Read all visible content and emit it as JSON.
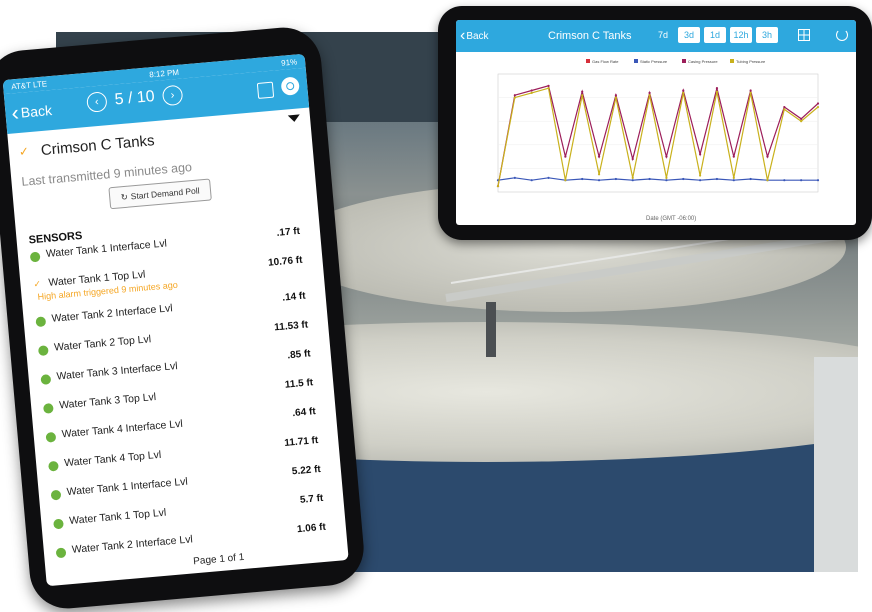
{
  "left_phone": {
    "status_bar": {
      "carrier": "AT&T LTE",
      "time": "8:12 PM",
      "battery": "91%"
    },
    "nav": {
      "back_label": "Back",
      "pager": "5 / 10"
    },
    "site_name": "Crimson C Tanks",
    "last_transmitted": "Last transmitted 9 minutes ago",
    "demand_poll_label": "Start Demand Poll",
    "sensors_title": "SENSORS",
    "sensors": [
      {
        "label": "Water Tank 1 Interface Lvl",
        "value": ".17 ft"
      },
      {
        "label": "Water Tank 1 Top Lvl",
        "value": "10.76 ft",
        "alarm": "High alarm triggered 9 minutes ago"
      },
      {
        "label": "Water Tank 2 Interface Lvl",
        "value": ".14 ft"
      },
      {
        "label": "Water Tank 2 Top Lvl",
        "value": "11.53 ft"
      },
      {
        "label": "Water Tank 3 Interface Lvl",
        "value": ".85 ft"
      },
      {
        "label": "Water Tank 3 Top Lvl",
        "value": "11.5 ft"
      },
      {
        "label": "Water Tank 4 Interface Lvl",
        "value": ".64 ft"
      },
      {
        "label": "Water Tank 4 Top Lvl",
        "value": "11.71 ft"
      },
      {
        "label": "Water Tank 1 Interface Lvl",
        "value": "5.22 ft"
      },
      {
        "label": "Water Tank 1 Top Lvl",
        "value": "5.7 ft"
      },
      {
        "label": "Water Tank 2 Interface Lvl",
        "value": "1.06 ft"
      }
    ],
    "page_label": "Page 1 of 1"
  },
  "right_phone": {
    "nav": {
      "back_label": "Back",
      "title": "Crimson C Tanks"
    },
    "ranges": [
      {
        "label": "7d",
        "selected": false
      },
      {
        "label": "3d",
        "selected": true
      },
      {
        "label": "1d",
        "selected": true
      },
      {
        "label": "12h",
        "selected": true
      },
      {
        "label": "3h",
        "selected": true
      }
    ]
  },
  "chart_data": {
    "type": "line",
    "title": "",
    "xlabel": "Date (GMT -06:00)",
    "ylabel": "",
    "legend": [
      "Gas Flow Rate",
      "Static Pressure",
      "Casing Pressure",
      "Tubing Pressure"
    ],
    "legend_placement": "top",
    "colors": {
      "Gas Flow Rate": "#d62f3a",
      "Static Pressure": "#3a57b8",
      "Casing Pressure": "#9c1e5a",
      "Tubing Pressure": "#c9b11c"
    },
    "series": [
      {
        "name": "Casing Pressure",
        "values": [
          0.05,
          0.82,
          0.86,
          0.9,
          0.3,
          0.85,
          0.3,
          0.82,
          0.28,
          0.84,
          0.3,
          0.86,
          0.32,
          0.88,
          0.3,
          0.86,
          0.3,
          0.72,
          0.62,
          0.75
        ]
      },
      {
        "name": "Static Pressure",
        "values": [
          0.1,
          0.12,
          0.1,
          0.12,
          0.1,
          0.11,
          0.1,
          0.11,
          0.1,
          0.11,
          0.1,
          0.11,
          0.1,
          0.11,
          0.1,
          0.11,
          0.1,
          0.1,
          0.1,
          0.1
        ]
      },
      {
        "name": "Tubing Pressure",
        "values": [
          0.05,
          0.8,
          0.84,
          0.88,
          0.1,
          0.82,
          0.15,
          0.8,
          0.12,
          0.82,
          0.12,
          0.84,
          0.14,
          0.85,
          0.12,
          0.84,
          0.1,
          0.7,
          0.6,
          0.72
        ]
      }
    ]
  }
}
